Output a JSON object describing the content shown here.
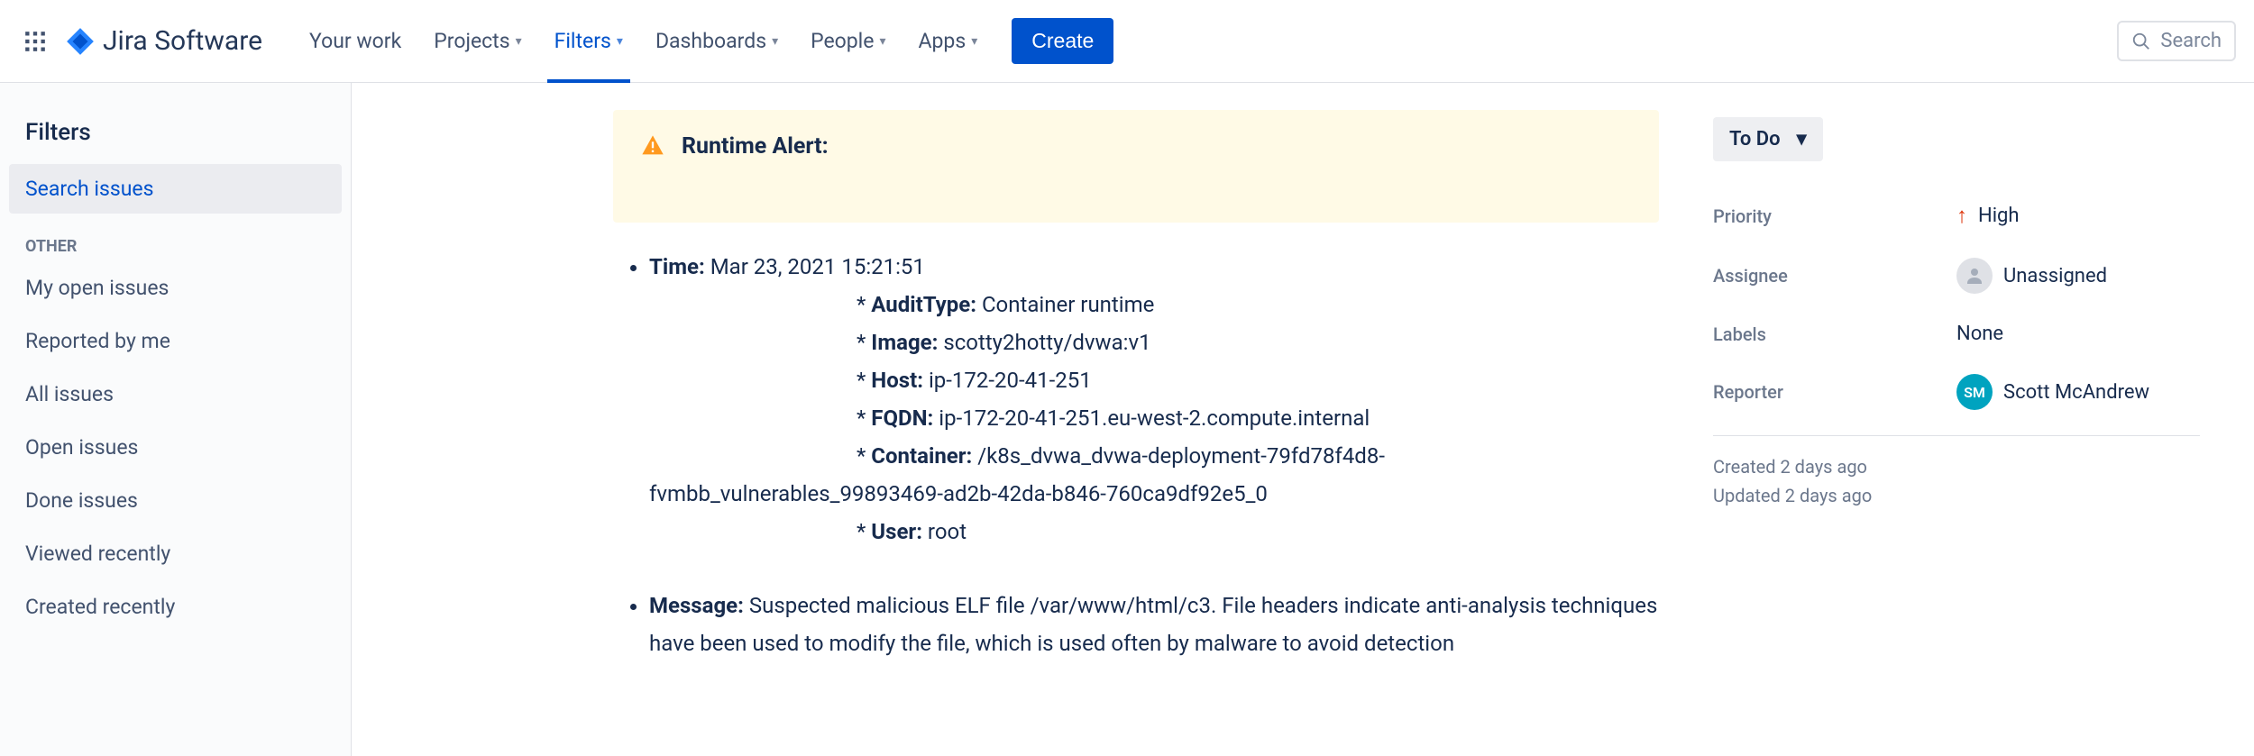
{
  "nav": {
    "logo_text": "Jira Software",
    "items": [
      {
        "label": "Your work",
        "dropdown": false,
        "active": false
      },
      {
        "label": "Projects",
        "dropdown": true,
        "active": false
      },
      {
        "label": "Filters",
        "dropdown": true,
        "active": true
      },
      {
        "label": "Dashboards",
        "dropdown": true,
        "active": false
      },
      {
        "label": "People",
        "dropdown": true,
        "active": false
      },
      {
        "label": "Apps",
        "dropdown": true,
        "active": false
      }
    ],
    "create_label": "Create",
    "search_placeholder": "Search"
  },
  "sidebar": {
    "title": "Filters",
    "primary_item": "Search issues",
    "section_label": "OTHER",
    "items": [
      "My open issues",
      "Reported by me",
      "All issues",
      "Open issues",
      "Done issues",
      "Viewed recently",
      "Created recently"
    ]
  },
  "issue": {
    "alert_title": "Runtime Alert:",
    "time_label": "Time:",
    "time_value": "Mar 23, 2021 15:21:51",
    "audit_type_label": "AuditType:",
    "audit_type_value": "Container runtime",
    "image_label": "Image:",
    "image_value": "scotty2hotty/dvwa:v1",
    "host_label": "Host:",
    "host_value": "ip-172-20-41-251",
    "fqdn_label": "FQDN:",
    "fqdn_value": "ip-172-20-41-251.eu-west-2.compute.internal",
    "container_label": "Container:",
    "container_value_line1": "/k8s_dvwa_dvwa-deployment-79fd78f4d8-",
    "container_value_line2": "fvmbb_vulnerables_99893469-ad2b-42da-b846-760ca9df92e5_0",
    "user_label": "User:",
    "user_value": "root",
    "message_label": "Message:",
    "message_value": "Suspected malicious ELF file /var/www/html/c3. File headers indicate anti-analysis techniques have been used to modify the file, which is used often by malware to avoid detection"
  },
  "panel": {
    "status": "To Do",
    "priority_label": "Priority",
    "priority_value": "High",
    "assignee_label": "Assignee",
    "assignee_value": "Unassigned",
    "labels_label": "Labels",
    "labels_value": "None",
    "reporter_label": "Reporter",
    "reporter_value": "Scott McAndrew",
    "reporter_initials": "SM",
    "created_line": "Created 2 days ago",
    "updated_line": "Updated 2 days ago"
  }
}
